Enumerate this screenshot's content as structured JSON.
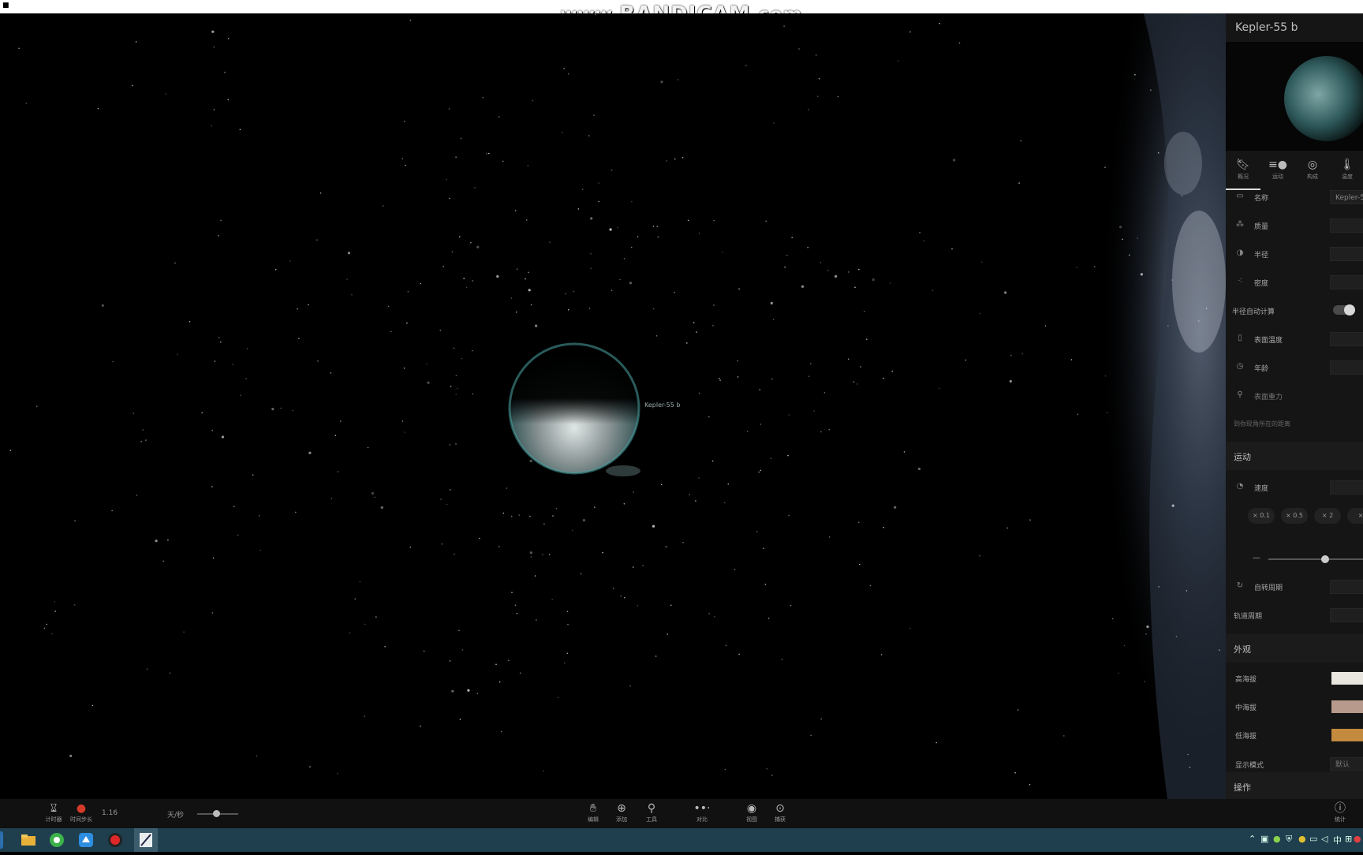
{
  "window": {
    "corner_mark": "■"
  },
  "watermark": {
    "prefix": "www.",
    "brand": "BANDICAM",
    "suffix": ".com"
  },
  "scene": {
    "planet_label": "Kepler-55 b"
  },
  "panel": {
    "title": "Kepler-55 b",
    "tabs": [
      {
        "label": "概况",
        "icon": "bookmark-icon"
      },
      {
        "label": "运动",
        "icon": "motion-icon"
      },
      {
        "label": "构成",
        "icon": "composition-icon"
      },
      {
        "label": "温度",
        "icon": "thermometer-icon"
      }
    ],
    "props": [
      {
        "label": "名称",
        "value": "Kepler-5",
        "icon": "tag-icon"
      },
      {
        "label": "质量",
        "value": "",
        "icon": "mass-icon"
      },
      {
        "label": "半径",
        "value": "",
        "icon": "radius-icon"
      },
      {
        "label": "密度",
        "value": "",
        "icon": "density-icon"
      },
      {
        "label": "半径自动计算",
        "value": "",
        "icon": ""
      },
      {
        "label": "表面温度",
        "value": "",
        "icon": "thermometer-icon"
      },
      {
        "label": "年龄",
        "value": "",
        "icon": "clock-icon"
      },
      {
        "label": "表面重力",
        "value": "",
        "icon": "gravity-icon"
      }
    ],
    "note": "到你现角所在的距离",
    "motion": {
      "title": "运动",
      "speed_label": "速度",
      "multipliers": [
        "× 0.1",
        "× 0.5",
        "× 2",
        "×"
      ],
      "slider_level": 0.6,
      "rotation_label": "自转周期",
      "orbit_label": "轨道周期"
    },
    "appearance": {
      "title": "外观",
      "high_label": "高海拔",
      "mid_label": "中海拔",
      "low_label": "低海拔",
      "high_color": "#e8e6de",
      "mid_color": "#b89a8c",
      "low_color": "#c48a3e",
      "display_label": "显示模式",
      "display_value": "默认"
    },
    "ops_title": "操作"
  },
  "bottom": {
    "timer_label": "计时器",
    "timestep_label": "时间步长",
    "speed_value": "1.16",
    "day_label": "天/秒",
    "tools": [
      "编辑",
      "添加",
      "工具",
      "对比",
      "视图",
      "捕获"
    ],
    "stats_label": "统计"
  },
  "taskbar": {
    "tray_lang": "中",
    "accent": "#1f3f4f"
  }
}
